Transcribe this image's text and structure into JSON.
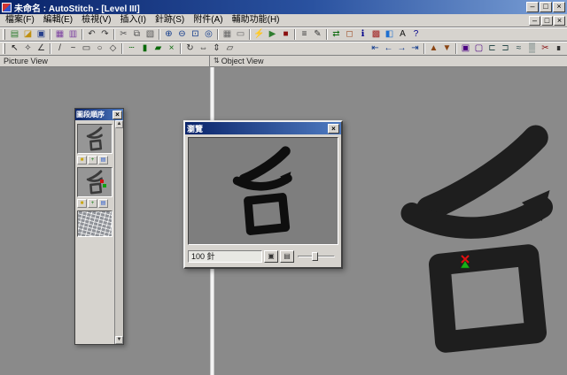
{
  "window": {
    "title": "未命名 : AutoStitch - [Level III]",
    "controls": {
      "minimize": "–",
      "maximize": "□",
      "close": "×"
    }
  },
  "menu": {
    "items": [
      {
        "n": "menu-item-file",
        "g": "檔案(F)"
      },
      {
        "n": "menu-item-edit",
        "g": "編輯(E)"
      },
      {
        "n": "menu-item-view",
        "g": "檢視(V)"
      },
      {
        "n": "menu-item-insert",
        "g": "插入(I)"
      },
      {
        "n": "menu-item-stitch",
        "g": "針跡(S)"
      },
      {
        "n": "menu-item-accessory",
        "g": "附件(A)"
      },
      {
        "n": "menu-item-helper",
        "g": "輔助功能(H)"
      }
    ],
    "mdi_controls": {
      "minimize": "–",
      "restore": "□",
      "close": "×"
    }
  },
  "toolbar_main": {
    "icons": [
      {
        "n": "new-design-icon",
        "g": "▤",
        "c": "#2f7d2f"
      },
      {
        "n": "open-design-icon",
        "g": "◪",
        "c": "#c09010"
      },
      {
        "n": "save-design-icon",
        "g": "▣",
        "c": "#27408b"
      },
      {
        "sep": true
      },
      {
        "n": "import-image-icon",
        "g": "▦",
        "c": "#7b3fa0"
      },
      {
        "n": "export-design-icon",
        "g": "▥",
        "c": "#7b3fa0"
      },
      {
        "sep": true
      },
      {
        "n": "undo-icon",
        "g": "↶",
        "c": "#333333"
      },
      {
        "n": "redo-icon",
        "g": "↷",
        "c": "#333333"
      },
      {
        "sep": true
      },
      {
        "n": "cut-icon",
        "g": "✂",
        "c": "#555555"
      },
      {
        "n": "copy-icon",
        "g": "⧉",
        "c": "#555555"
      },
      {
        "n": "paste-icon",
        "g": "▧",
        "c": "#555555"
      },
      {
        "sep": true
      },
      {
        "n": "zoom-in-icon",
        "g": "⊕",
        "c": "#103a8c"
      },
      {
        "n": "zoom-out-icon",
        "g": "⊖",
        "c": "#103a8c"
      },
      {
        "n": "zoom-fit-icon",
        "g": "⊡",
        "c": "#103a8c"
      },
      {
        "n": "pan-icon",
        "g": "◎",
        "c": "#103a8c"
      },
      {
        "sep": true
      },
      {
        "n": "grid-toggle-icon",
        "g": "▦",
        "c": "#666666"
      },
      {
        "n": "ruler-toggle-icon",
        "g": "▭",
        "c": "#666666"
      },
      {
        "sep": true
      },
      {
        "n": "generate-stitches-icon",
        "g": "⚡",
        "c": "#d8a800"
      },
      {
        "n": "simulate-icon",
        "g": "▶",
        "c": "#2f7d2f"
      },
      {
        "n": "stop-simulate-icon",
        "g": "■",
        "c": "#8b1010"
      },
      {
        "sep": true
      },
      {
        "n": "stitch-list-icon",
        "g": "≡",
        "c": "#333333"
      },
      {
        "n": "properties-icon",
        "g": "✎",
        "c": "#333333"
      },
      {
        "sep": true
      },
      {
        "n": "machine-send-icon",
        "g": "⇄",
        "c": "#0a6a0a"
      },
      {
        "n": "hoop-select-icon",
        "g": "◻",
        "c": "#a0522d"
      },
      {
        "n": "design-info-icon",
        "g": "ℹ",
        "c": "#00008b"
      },
      {
        "n": "thread-chart-icon",
        "g": "▩",
        "c": "#a02020"
      },
      {
        "n": "color-palette-icon",
        "g": "◧",
        "c": "#1e6fd0"
      },
      {
        "n": "lettering-icon",
        "g": "A",
        "c": "#111111"
      },
      {
        "n": "help-icon",
        "g": "?",
        "c": "#00008b"
      }
    ]
  },
  "toolbar_tools": {
    "icons": [
      {
        "n": "select-tool-icon",
        "g": "↖",
        "c": "#111111"
      },
      {
        "n": "node-edit-icon",
        "g": "✧",
        "c": "#333333"
      },
      {
        "n": "measure-icon",
        "g": "∠",
        "c": "#333333"
      },
      {
        "sep": true
      },
      {
        "n": "line-tool-icon",
        "g": "/",
        "c": "#333333"
      },
      {
        "n": "curve-tool-icon",
        "g": "~",
        "c": "#333333"
      },
      {
        "n": "rect-tool-icon",
        "g": "▭",
        "c": "#333333"
      },
      {
        "n": "ellipse-tool-icon",
        "g": "○",
        "c": "#333333"
      },
      {
        "n": "polygon-tool-icon",
        "g": "◇",
        "c": "#333333"
      },
      {
        "sep": true
      },
      {
        "n": "run-stitch-icon",
        "g": "┄",
        "c": "#0a6a0a"
      },
      {
        "n": "satin-stitch-icon",
        "g": "▮",
        "c": "#0a6a0a"
      },
      {
        "n": "fill-stitch-icon",
        "g": "▰",
        "c": "#0a6a0a"
      },
      {
        "n": "cross-stitch-icon",
        "g": "×",
        "c": "#0a6a0a"
      },
      {
        "sep": true
      },
      {
        "n": "rotate-icon",
        "g": "↻",
        "c": "#333333"
      },
      {
        "n": "mirror-horizontal-icon",
        "g": "⇔",
        "c": "#333333"
      },
      {
        "n": "mirror-vertical-icon",
        "g": "⇕",
        "c": "#333333"
      },
      {
        "n": "resize-icon",
        "g": "▱",
        "c": "#333333"
      },
      {
        "gap": true
      },
      {
        "n": "first-segment-icon",
        "g": "⇤",
        "c": "#103a8c"
      },
      {
        "n": "prev-segment-icon",
        "g": "←",
        "c": "#103a8c"
      },
      {
        "n": "next-segment-icon",
        "g": "→",
        "c": "#103a8c"
      },
      {
        "n": "last-segment-icon",
        "g": "⇥",
        "c": "#103a8c"
      },
      {
        "sep": true
      },
      {
        "n": "move-up-icon",
        "g": "▲",
        "c": "#8b4513"
      },
      {
        "n": "move-down-icon",
        "g": "▼",
        "c": "#8b4513"
      },
      {
        "sep": true
      },
      {
        "n": "group-icon",
        "g": "▣",
        "c": "#4b0082"
      },
      {
        "n": "ungroup-icon",
        "g": "▢",
        "c": "#4b0082"
      },
      {
        "n": "align-left-icon",
        "g": "⊏",
        "c": "#2f4f4f"
      },
      {
        "n": "align-right-icon",
        "g": "⊐",
        "c": "#2f4f4f"
      },
      {
        "n": "density-icon",
        "g": "≈",
        "c": "#2f4f4f"
      },
      {
        "n": "underlay-icon",
        "g": "▒",
        "c": "#2f4f4f"
      },
      {
        "n": "trim-icon",
        "g": "✂",
        "c": "#8b1010"
      },
      {
        "n": "lock-icon",
        "g": "∎",
        "c": "#333333"
      }
    ]
  },
  "pane_headers": {
    "picture": "Picture View",
    "object": "Object View",
    "object_icon": "⇅"
  },
  "palette": {
    "title": "圖段順序",
    "scroll_up": "▲",
    "scroll_down": "▼",
    "item_icons": [
      {
        "n": "segment-color-icon",
        "g": "■",
        "c": "#caa400"
      },
      {
        "n": "segment-stitch-icon",
        "g": "+",
        "c": "#0a7a0a"
      },
      {
        "n": "segment-edit-icon",
        "g": "▤",
        "c": "#2255cc"
      }
    ]
  },
  "preview": {
    "title": "瀏覽",
    "count_value": "100 針",
    "buttons": [
      {
        "n": "preview-fit-button",
        "g": "▣"
      },
      {
        "n": "preview-speed-button",
        "g": "▤"
      }
    ]
  },
  "glyph": {
    "character": "台"
  },
  "colors": {
    "titlebar": "#0a246a",
    "toolbar_bg": "#d6d3ce",
    "workspace": "#8a8a8a",
    "glyph": "#1e1e1e",
    "marker_red": "#e01010",
    "marker_green": "#18b018"
  }
}
